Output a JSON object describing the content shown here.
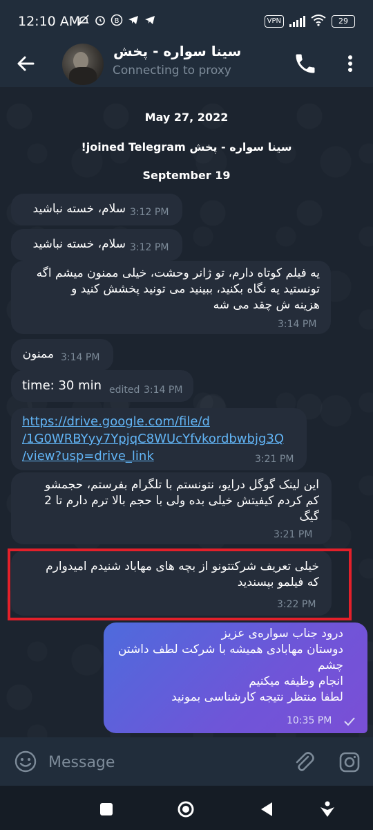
{
  "status_bar": {
    "time": "12:10 AM",
    "vpn": "VPN",
    "battery": "29"
  },
  "header": {
    "title": "سینا سواره - پخش",
    "subtitle": "Connecting to proxy"
  },
  "chat": {
    "date_1": "May 27, 2022",
    "service_joined": "سینا سواره - پخش joined Telegram!",
    "date_2": "September 19",
    "messages": [
      {
        "text": "سلام، خسته نباشید",
        "time": "3:12 PM"
      },
      {
        "text": "سلام، خسته نباشید",
        "time": "3:12 PM"
      },
      {
        "text": "یه فیلم کوتاه دارم، تو ژانر وحشت، خیلی ممنون میشم اگه\nتونستید یه نگاه بکنید، ببینید می تونید پخشش کنید و\nهزینه ش چقد می شه",
        "time": "3:14 PM"
      },
      {
        "text": "ممنون",
        "time": "3:14 PM"
      },
      {
        "text": "time: 30 min",
        "edited": "edited",
        "time": "3:14 PM"
      },
      {
        "link_lines": [
          "https://drive.google.com/file/d",
          "/1G0WRBYyy7YpjqC8WUcYfvkordbwbjg3Q",
          "/view?usp=drive_link"
        ],
        "time": "3:21 PM"
      },
      {
        "text": "این لینک گوگل درایو، نتونستم با تلگرام بفرستم، حجمشو\nکم کردم کیفیتش خیلی بده ولی با حجم بالا ترم دارم تا 2\nگیگ",
        "time": "3:21 PM"
      },
      {
        "text": "خیلی تعریف شرکتتونو از بچه های مهاباد شنیدم امیدوارم\nکه فیلمو بپسندید",
        "time": "3:22 PM"
      }
    ],
    "outgoing": {
      "lines": [
        "درود جناب سواره‌ی عزیز",
        "دوستان مهابادی همیشه با شرکت لطف داشتن",
        "چشم",
        "انجام وظیفه میکنیم",
        "لطفا منتظر نتیجه کارشناسی بمونید"
      ],
      "time": "10:35 PM"
    }
  },
  "input": {
    "placeholder": "Message"
  },
  "colors": {
    "accent": "#62b5f6",
    "highlight": "#e3202a",
    "bubble_in": "#252d3a",
    "bubble_out_start": "#4e6bdc",
    "bubble_out_end": "#7a4fd6"
  },
  "icons": [
    "back-arrow-icon",
    "phone-icon",
    "more-vertical-icon",
    "emoji-icon",
    "paperclip-icon",
    "camera-icon",
    "square-icon",
    "circle-icon",
    "triangle-icon",
    "accessibility-icon",
    "checkmark-icon"
  ]
}
